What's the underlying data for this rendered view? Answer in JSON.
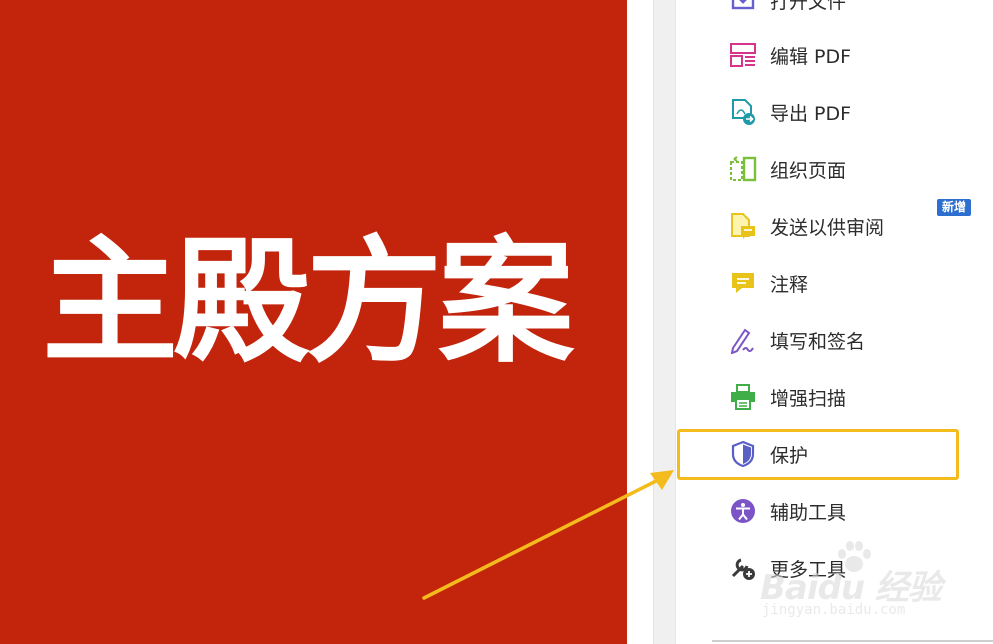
{
  "document": {
    "title": "主殿方案"
  },
  "tools": {
    "items": [
      {
        "key": "open-file",
        "label": "打开文件",
        "icon": "open-file-icon",
        "color": "#6a5fce"
      },
      {
        "key": "edit-pdf",
        "label": "编辑 PDF",
        "icon": "edit-pdf-icon",
        "color": "#d6348a"
      },
      {
        "key": "export-pdf",
        "label": "导出 PDF",
        "icon": "export-pdf-icon",
        "color": "#1f9aa8"
      },
      {
        "key": "organize-pages",
        "label": "组织页面",
        "icon": "organize-pages-icon",
        "color": "#7bbf3a"
      },
      {
        "key": "send-for-review",
        "label": "发送以供审阅",
        "icon": "send-review-icon",
        "color": "#e8c31a"
      },
      {
        "key": "comment",
        "label": "注释",
        "icon": "comment-icon",
        "color": "#e8c31a"
      },
      {
        "key": "fill-sign",
        "label": "填写和签名",
        "icon": "fill-sign-icon",
        "color": "#7b55c7"
      },
      {
        "key": "enhance-scan",
        "label": "增强扫描",
        "icon": "enhance-scan-icon",
        "color": "#3fae49"
      },
      {
        "key": "protect",
        "label": "保护",
        "icon": "shield-icon",
        "color": "#5a5fc6"
      },
      {
        "key": "accessibility",
        "label": "辅助工具",
        "icon": "accessibility-icon",
        "color": "#7b55c7"
      },
      {
        "key": "more-tools",
        "label": "更多工具",
        "icon": "wrench-add-icon",
        "color": "#3a3a3a"
      }
    ],
    "new_badge": "新增"
  },
  "watermark": {
    "brand": "Baidu 经验",
    "url": "jingyan.baidu.com"
  },
  "colors": {
    "document_bg": "#c3240c",
    "highlight": "#f4bb1c",
    "badge_bg": "#2d6fce"
  }
}
